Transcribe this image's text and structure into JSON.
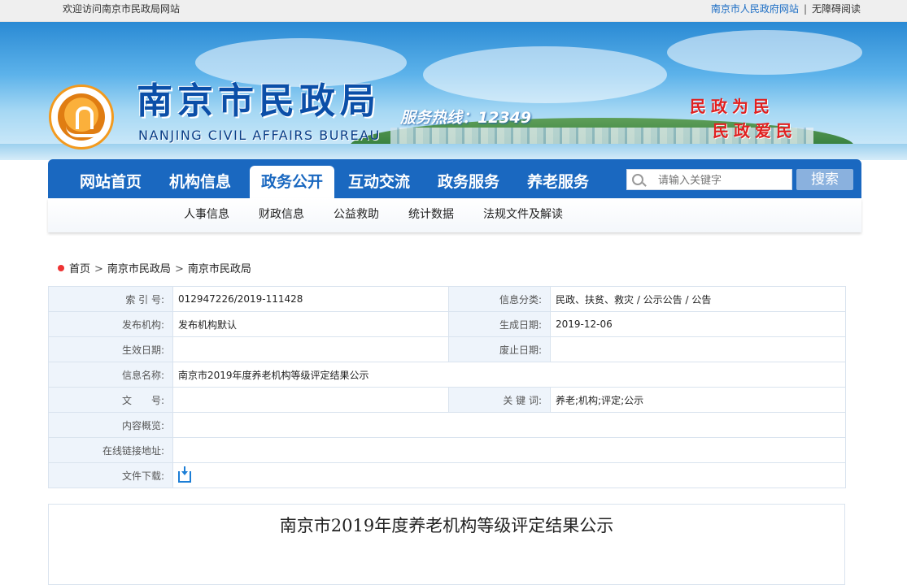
{
  "topbar": {
    "welcome": "欢迎访问南京市民政局网站",
    "gov_link": "南京市人民政府网站",
    "separator": "|",
    "accessibility": "无障碍阅读"
  },
  "header": {
    "title": "南京市民政局",
    "subtitle": "NANJING CIVIL AFFAIRS BUREAU",
    "hotline": "服务热线：12349",
    "slogan_1": "民政为民",
    "slogan_2": "民政爱民",
    "logo_icon": "bureau-emblem-icon"
  },
  "nav": {
    "items": [
      {
        "label": "网站首页"
      },
      {
        "label": "机构信息"
      },
      {
        "label": "政务公开",
        "active": true
      },
      {
        "label": "互动交流"
      },
      {
        "label": "政务服务"
      },
      {
        "label": "养老服务"
      }
    ],
    "search_placeholder": "请输入关键字",
    "search_button": "搜索"
  },
  "subnav": {
    "items": [
      "人事信息",
      "财政信息",
      "公益救助",
      "统计数据",
      "法规文件及解读"
    ]
  },
  "breadcrumb": {
    "items": [
      "首页",
      "南京市民政局",
      "南京市民政局"
    ],
    "arrow": ">"
  },
  "meta": {
    "index_label": "索 引 号:",
    "index_value": "012947226/2019-111428",
    "category_label": "信息分类:",
    "category_value": "民政、扶贫、救灾 / 公示公告 / 公告",
    "publisher_label": "发布机构:",
    "publisher_value": "发布机构默认",
    "created_label": "生成日期:",
    "created_value": "2019-12-06",
    "effective_label": "生效日期:",
    "effective_value": "",
    "expired_label": "废止日期:",
    "expired_value": "",
    "name_label": "信息名称:",
    "name_value": "南京市2019年度养老机构等级评定结果公示",
    "docno_label": "文　　号:",
    "docno_value": "",
    "keywords_label": "关 键 词:",
    "keywords_value": "养老;机构;评定;公示",
    "summary_label": "内容概览:",
    "summary_value": "",
    "link_label": "在线链接地址:",
    "link_value": "",
    "download_label": "文件下载:",
    "download_icon": "download-icon"
  },
  "article": {
    "title": "南京市2019年度养老机构等级评定结果公示"
  },
  "colors": {
    "nav_blue": "#1a68c0",
    "label_bg": "#eef4fb",
    "slogan_red": "#e02020"
  }
}
